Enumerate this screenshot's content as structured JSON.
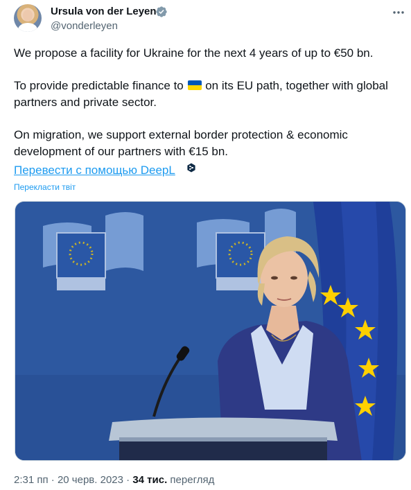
{
  "author": {
    "name": "Ursula von der Leyen",
    "handle": "@vonderleyen",
    "avatar_icon": "avatar-photo",
    "verified_icon": "verified-badge-icon",
    "verified_color": "#829aab"
  },
  "tweet": {
    "para1": "We propose a facility for Ukraine for the next 4 years of up to €50 bn.",
    "para2_before_flag": "To provide predictable finance to ",
    "flag_icon": "ukraine-flag-icon",
    "para2_after_flag": " on its EU path, together with global",
    "para2_line2": "partners and private sector.",
    "para3_line1": "On migration, we support external border protection & economic",
    "para3_line2": "development of our partners with €15 bn."
  },
  "translation": {
    "deepl_link": "Перевести с помощью DeepL",
    "deepl_icon": "deepl-icon",
    "translate_tweet": "Перекласти твіт"
  },
  "media": {
    "image_icon": "press-photo"
  },
  "meta": {
    "time": "2:31 пп",
    "separator1": " · ",
    "date": "20 черв. 2023",
    "separator2": " · ",
    "views_count": "34 тис.",
    "views_label": " перегляд"
  },
  "colors": {
    "accent": "#1d9bf0",
    "text": "#0f1419",
    "secondary": "#536471",
    "eu_blue": "#2f5aa3",
    "flag_blue": "#0057b7",
    "flag_yellow": "#ffd700"
  }
}
